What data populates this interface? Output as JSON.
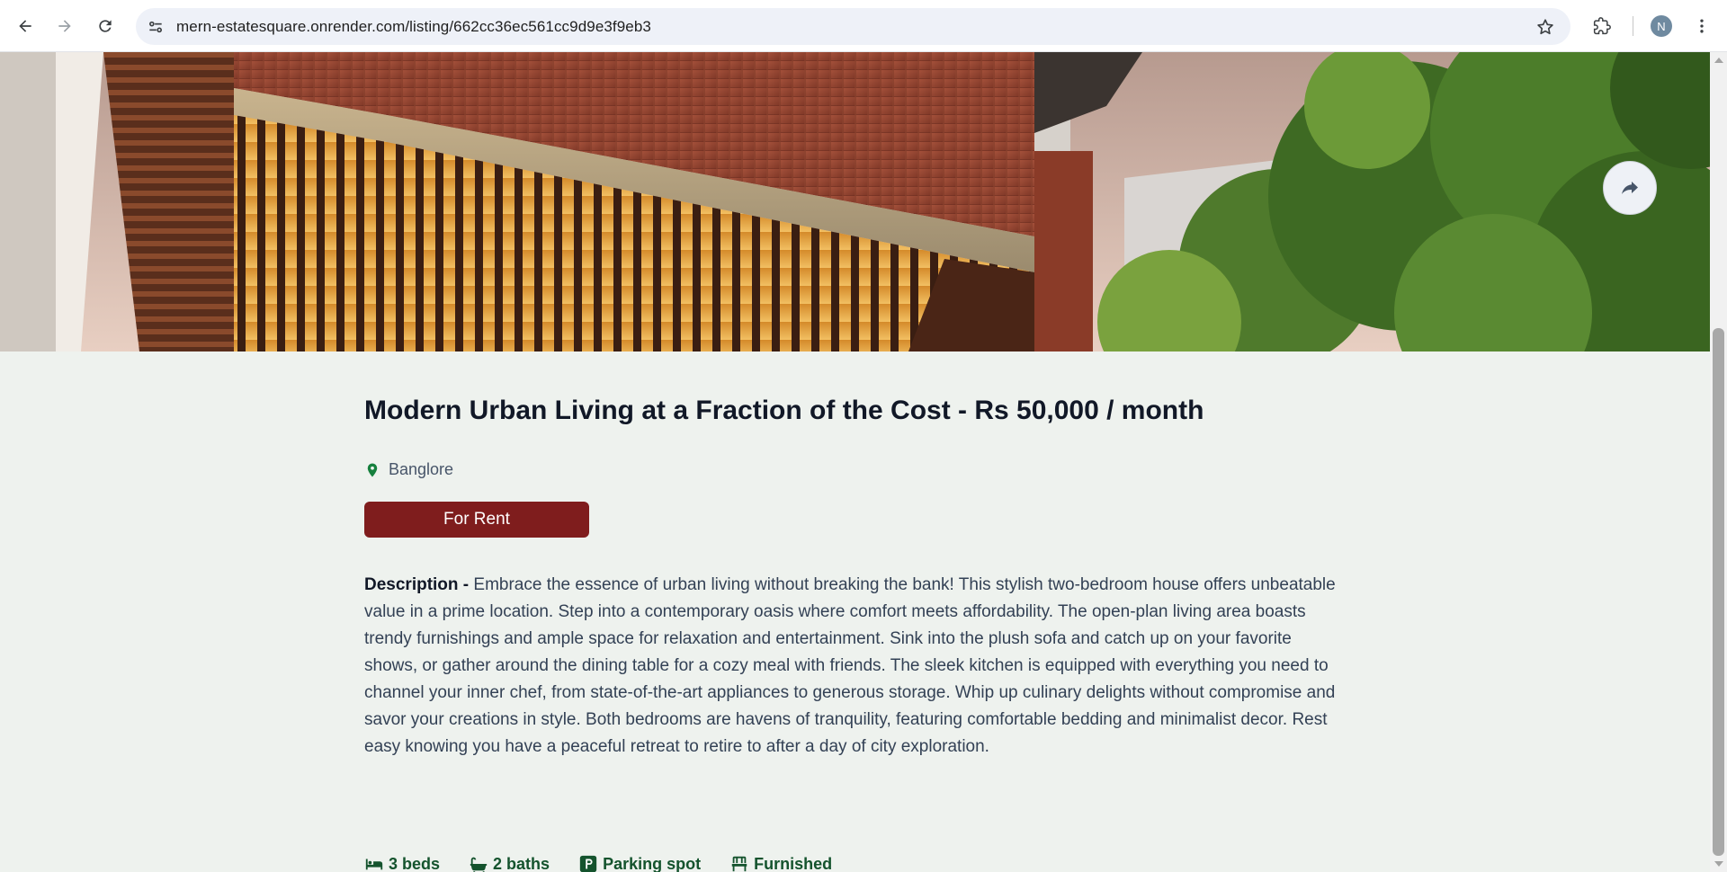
{
  "browser": {
    "url": "mern-estatesquare.onrender.com/listing/662cc36ec561cc9d9e3f9eb3",
    "profile_initial": "N",
    "icons": [
      "back-icon",
      "forward-icon",
      "reload-icon",
      "site-info-icon",
      "star-icon",
      "extensions-icon",
      "kebab-menu-icon"
    ]
  },
  "listing": {
    "title": "Modern Urban Living at a Fraction of the Cost - Rs 50,000 / month",
    "location": "Banglore",
    "type_badge": "For Rent",
    "description_label": "Description - ",
    "description_text": "Embrace the essence of urban living without breaking the bank! This stylish two-bedroom house offers unbeatable value in a prime location. Step into a contemporary oasis where comfort meets affordability. The open-plan living area boasts trendy furnishings and ample space for relaxation and entertainment. Sink into the plush sofa and catch up on your favorite shows, or gather around the dining table for a cozy meal with friends. The sleek kitchen is equipped with everything you need to channel your inner chef, from state-of-the-art appliances to generous storage. Whip up culinary delights without compromise and savor your creations in style. Both bedrooms are havens of tranquility, featuring comfortable bedding and minimalist decor. Rest easy knowing you have a peaceful retreat to retire to after a day of city exploration.",
    "amenities": {
      "beds": "3 beds",
      "baths": "2 baths",
      "parking": "Parking spot",
      "furnished": "Furnished"
    }
  },
  "colors": {
    "page_background": "#eef2ee",
    "badge_background": "#7f1d1d",
    "amenity_text": "#14532d",
    "location_pin": "#15803d"
  }
}
